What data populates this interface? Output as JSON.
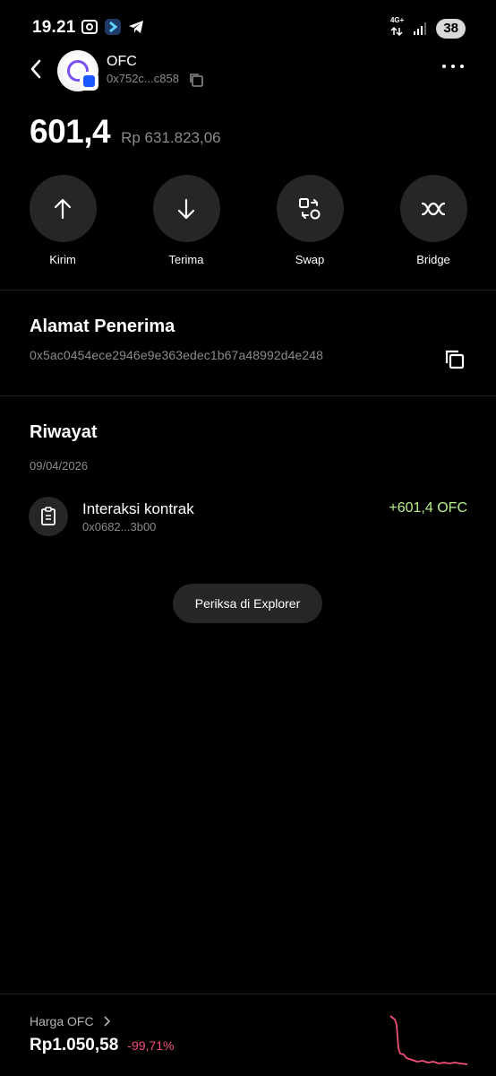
{
  "status_bar": {
    "time": "19.21",
    "network": "4G+",
    "battery": "38"
  },
  "header": {
    "token_name": "OFC",
    "token_address": "0x752c...c858"
  },
  "balance": {
    "amount": "601,4",
    "fiat": "Rp 631.823,06"
  },
  "actions": [
    {
      "label": "Kirim",
      "icon": "arrow-up-icon"
    },
    {
      "label": "Terima",
      "icon": "arrow-down-icon"
    },
    {
      "label": "Swap",
      "icon": "swap-icon"
    },
    {
      "label": "Bridge",
      "icon": "bridge-icon"
    }
  ],
  "recipient": {
    "title": "Alamat Penerima",
    "address": "0x5ac0454ece2946e9e363edec1b67a48992d4e248"
  },
  "history": {
    "title": "Riwayat",
    "date": "09/04/2026",
    "items": [
      {
        "title": "Interaksi kontrak",
        "hash": "0x0682...3b00",
        "amount": "+601,4 OFC"
      }
    ],
    "explorer_label": "Periksa di Explorer"
  },
  "price": {
    "label": "Harga OFC",
    "value": "Rp1.050,58",
    "change": "-99,71%"
  },
  "colors": {
    "background": "#000000",
    "surface": "#262626",
    "positive": "#b7ef8a",
    "negative": "#f0507a",
    "secondary_text": "#8b8b8b"
  }
}
